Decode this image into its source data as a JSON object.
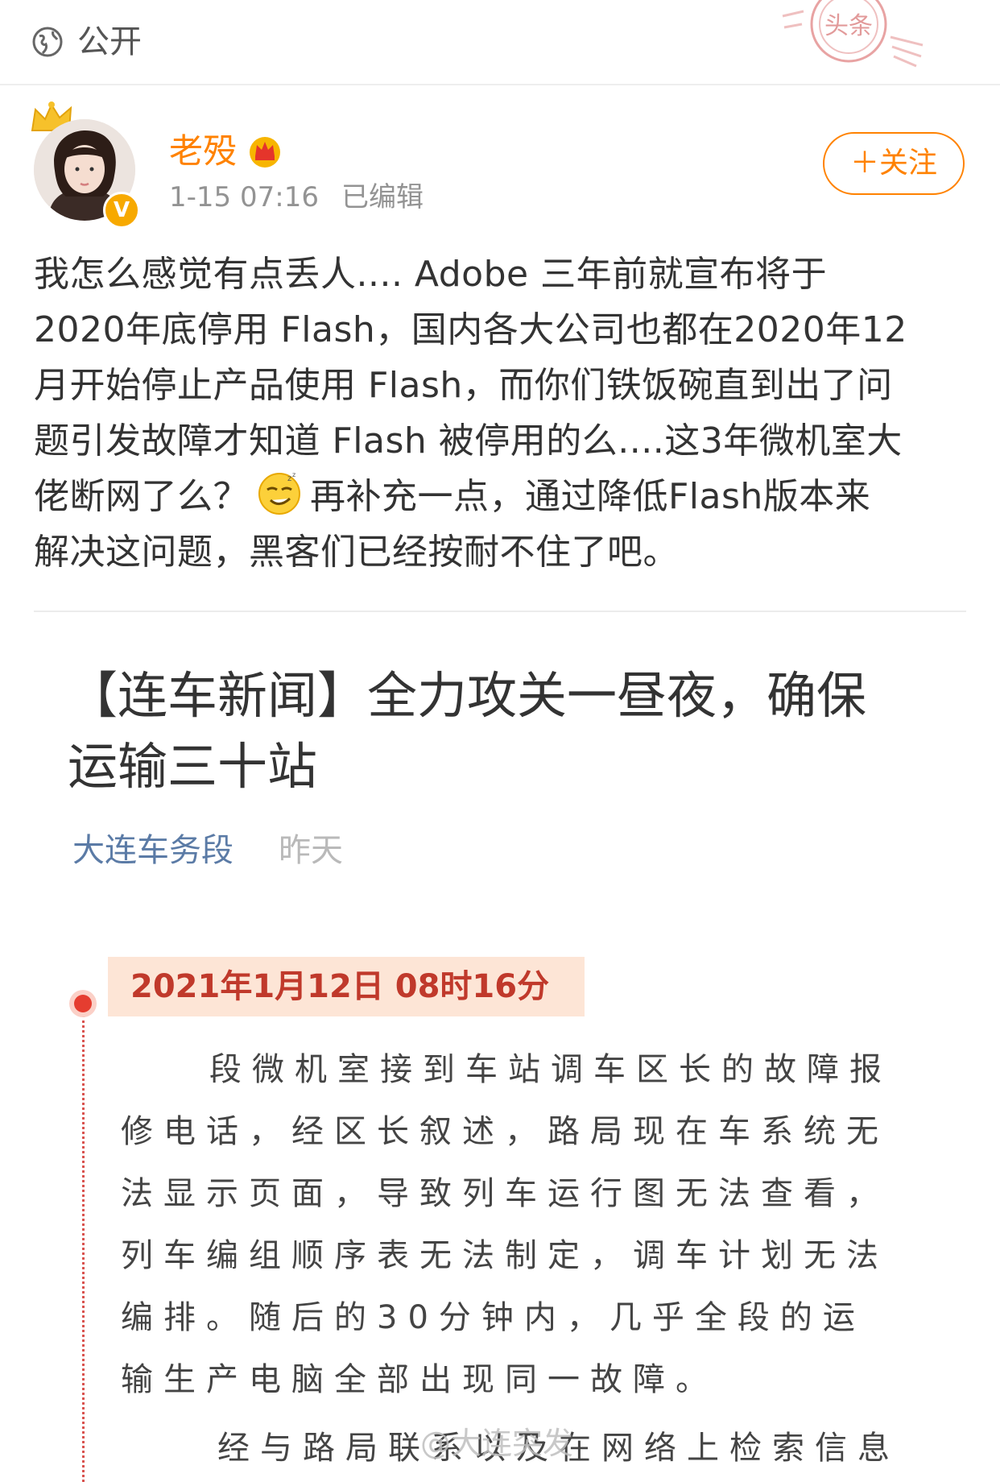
{
  "header": {
    "visibility_label": "公开",
    "visibility_icon": "globe-icon",
    "stamp_text": "头条"
  },
  "author": {
    "name": "老殁",
    "verified_badge": "V",
    "post_time": "1-15 07:16",
    "edited_label": "已编辑",
    "follow_label": "＋关注"
  },
  "post": {
    "line1": "我怎么感觉有点丢人.... Adobe 三年前就宣布将于",
    "line2": "2020年底停用 Flash，国内各大公司也都在2020年12",
    "line3": "月开始停止产品使用 Flash，而你们铁饭碗直到出了问",
    "line4": "题引发故障才知道 Flash 被停用的么....这3年微机室大",
    "line5a": "佬断网了么？",
    "line5b": "再补充一点，通过降低Flash版本来",
    "line6": "解决这问题，黑客们已经按耐不住了吧。"
  },
  "article": {
    "title_line1": "【连车新闻】全力攻关一昼夜，确保",
    "title_line2": "运输三十站",
    "source": "大连车务段",
    "date": "昨天",
    "time_heading": "2021年1月12日 08时16分",
    "paragraph1": "段微机室接到车站调车区长的故障报修电话，经区长叙述，路局现在车系统无法显示页面，导致列车运行图无法查看，列车编组顺序表无法制定，调车计划无法编排。随后的30分钟内，几乎全段的运输生产电脑全部出现同一故障。",
    "paragraph2": "经与路局联系以及在网络上检索信息"
  },
  "watermark": "@大连突发",
  "colors": {
    "accent": "#ff8200",
    "source_blue": "#5b7ba6",
    "timeline_red": "#c0392b",
    "time_box": "#fde5d6"
  }
}
